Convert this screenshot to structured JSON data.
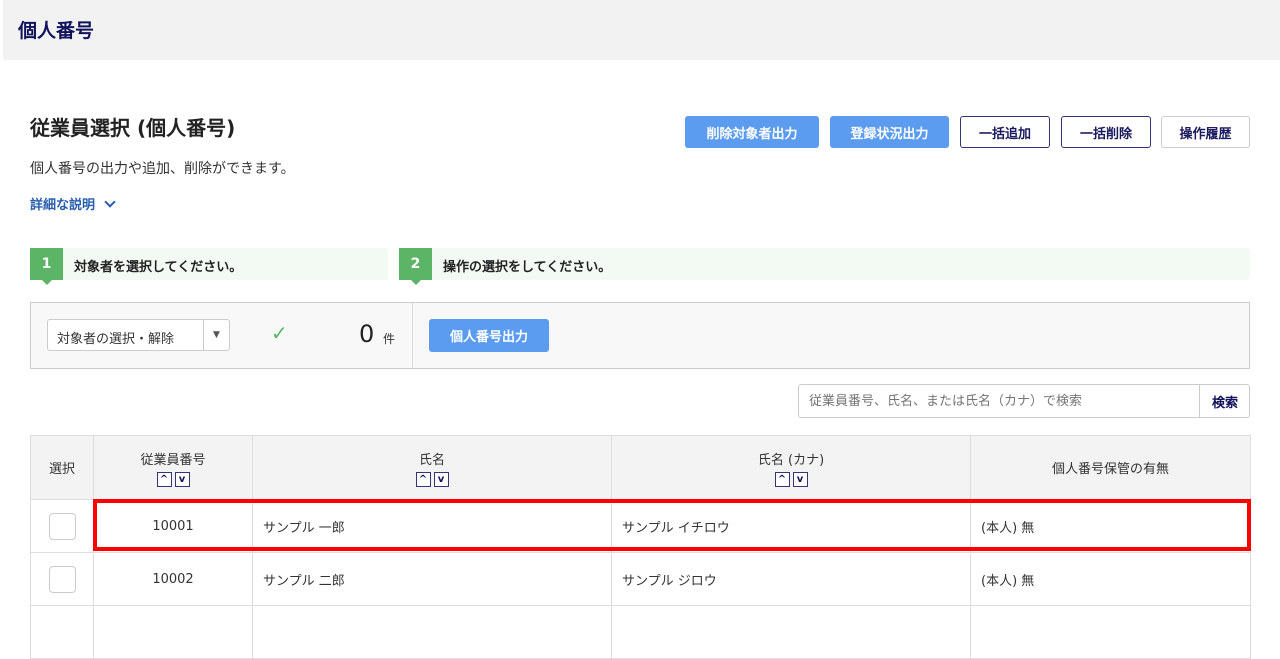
{
  "header": {
    "title": "個人番号"
  },
  "page": {
    "title": "従業員選択 (個人番号)",
    "description": "個人番号の出力や追加、削除ができます。",
    "details_link": "詳細な説明"
  },
  "toolbar": {
    "export_deleted": "削除対象者出力",
    "export_status": "登録状況出力",
    "bulk_add": "一括追加",
    "bulk_delete": "一括削除",
    "history": "操作履歴"
  },
  "steps": [
    {
      "num": "1",
      "label": "対象者を選択してください。"
    },
    {
      "num": "2",
      "label": "操作の選択をしてください。"
    }
  ],
  "panel": {
    "select_label": "対象者の選択・解除",
    "count": "0",
    "count_unit": "件",
    "export_button": "個人番号出力"
  },
  "search": {
    "placeholder": "従業員番号、氏名、または氏名（カナ）で検索",
    "button": "検索"
  },
  "table": {
    "headers": [
      "選択",
      "従業員番号",
      "氏名",
      "氏名 (カナ)",
      "個人番号保管の有無"
    ],
    "rows": [
      {
        "id": "10001",
        "name": "サンプル 一郎",
        "kana": "サンプル イチロウ",
        "status": "(本人) 無"
      },
      {
        "id": "10002",
        "name": "サンプル 二郎",
        "kana": "サンプル ジロウ",
        "status": "(本人) 無"
      }
    ]
  }
}
